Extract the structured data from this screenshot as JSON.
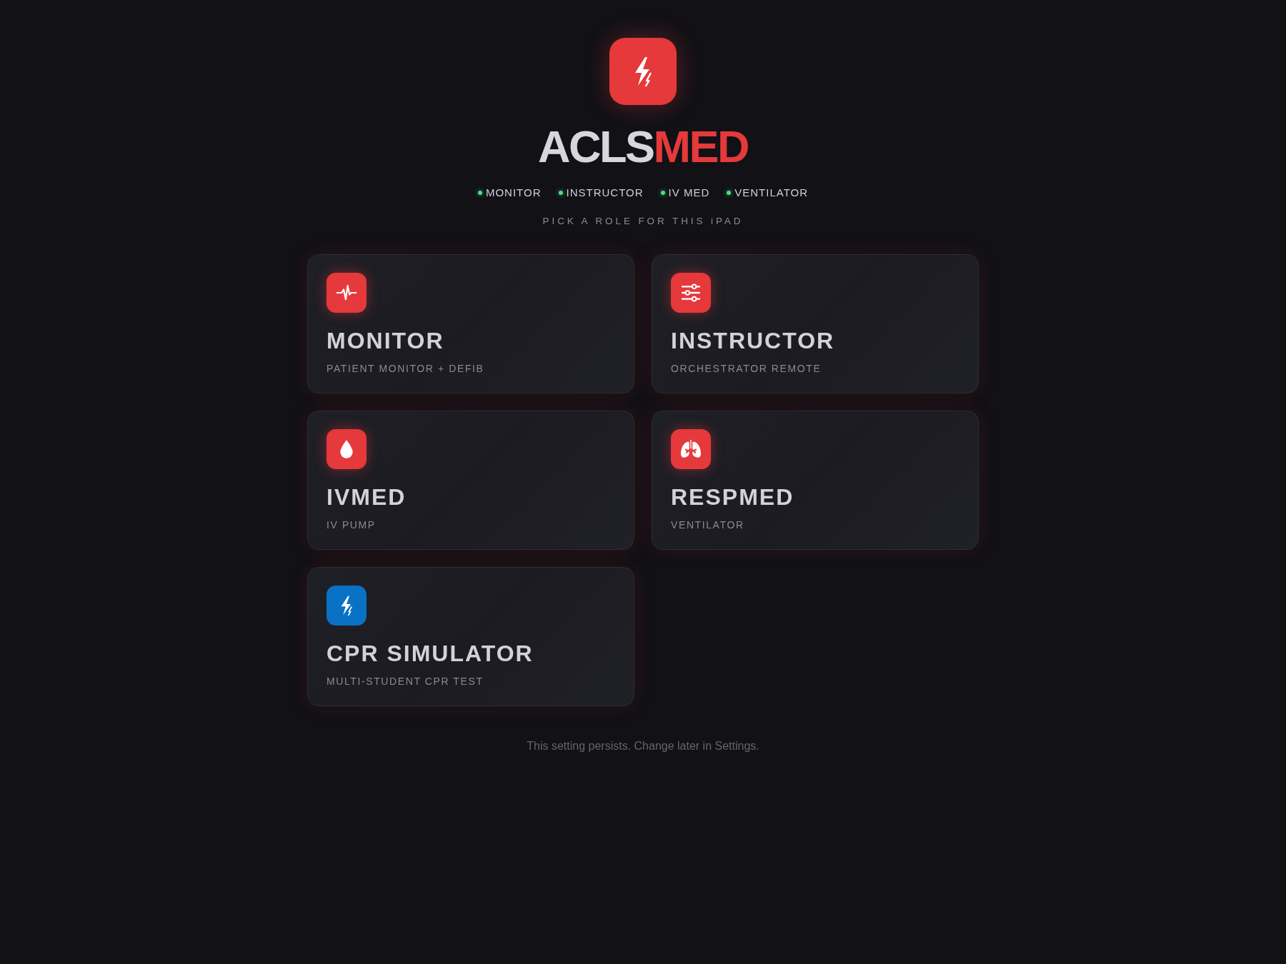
{
  "header": {
    "title_main": "ACLS",
    "title_accent": "MED"
  },
  "status": [
    {
      "label": "MONITOR",
      "online": true
    },
    {
      "label": "INSTRUCTOR",
      "online": true
    },
    {
      "label": "IV MED",
      "online": true
    },
    {
      "label": "VENTILATOR",
      "online": true
    }
  ],
  "prompt": "PICK A ROLE FOR THIS iPAD",
  "roles": [
    {
      "title": "MONITOR",
      "subtitle": "PATIENT MONITOR + DEFIB",
      "color": "#e5393b"
    },
    {
      "title": "INSTRUCTOR",
      "subtitle": "ORCHESTRATOR REMOTE",
      "color": "#e5393b"
    },
    {
      "title": "IVMED",
      "subtitle": "IV PUMP",
      "color": "#e5393b"
    },
    {
      "title": "RESPMED",
      "subtitle": "VENTILATOR",
      "color": "#e5393b"
    },
    {
      "title": "CPR SIMULATOR",
      "subtitle": "MULTI-STUDENT CPR TEST",
      "color": "#0a72c4"
    }
  ],
  "footer": "This setting persists. Change later in Settings."
}
